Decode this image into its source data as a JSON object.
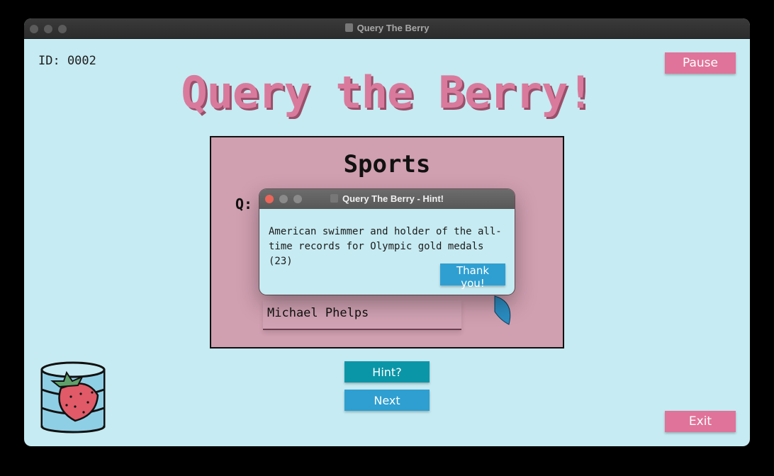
{
  "window": {
    "title": "Query The Berry",
    "buttons": [
      "close",
      "minimize",
      "zoom"
    ]
  },
  "header": {
    "id_text": "ID: 0002",
    "title": "Query the Berry!",
    "pause_label": "Pause"
  },
  "card": {
    "category": "Sports",
    "question_label": "Q:",
    "answer_value": "Michael Phelps"
  },
  "controls": {
    "hint_label": "Hint?",
    "next_label": "Next",
    "exit_label": "Exit"
  },
  "dialog": {
    "title": "Query The Berry - Hint!",
    "text": "American swimmer and holder of the all-time records for Olympic gold medals (23)",
    "button_label": "Thank you!"
  },
  "colors": {
    "background": "#c6ebf2",
    "title_pink": "#d97a9d",
    "card_pink": "#d09fb0",
    "button_pink": "#e07399",
    "button_teal": "#0b96a8",
    "button_blue": "#2e9fd0"
  },
  "icons": {
    "logo": "strawberry-database-icon",
    "spinner": "spinner-icon"
  }
}
